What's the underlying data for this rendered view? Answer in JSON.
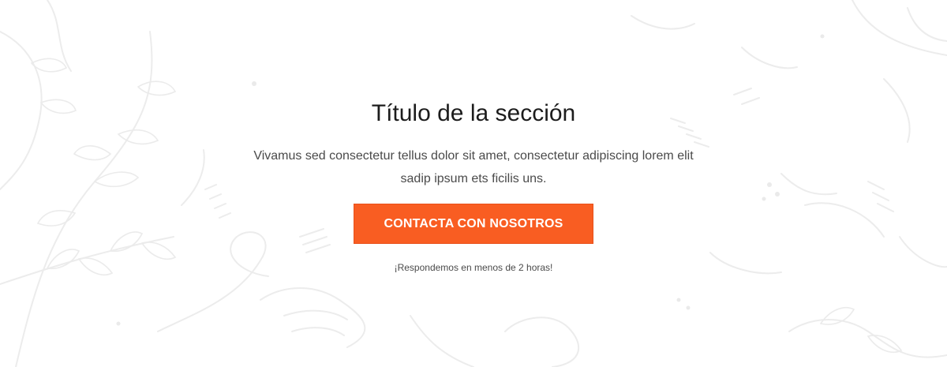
{
  "section": {
    "title": "Título de la sección",
    "description": "Vivamus sed consectetur tellus dolor sit amet, consectetur adipiscing lorem elit sadip ipsum ets ficilis uns.",
    "cta_label": "CONTACTA CON NOSOTROS",
    "note": "¡Respondemos en menos de 2 horas!"
  },
  "colors": {
    "accent": "#f95d22",
    "title": "#1c1c1c",
    "text": "#4a4a4a",
    "background": "#ffffff",
    "pattern": "#ececec"
  },
  "icons": {
    "background": "botanical-sketch-pattern"
  }
}
